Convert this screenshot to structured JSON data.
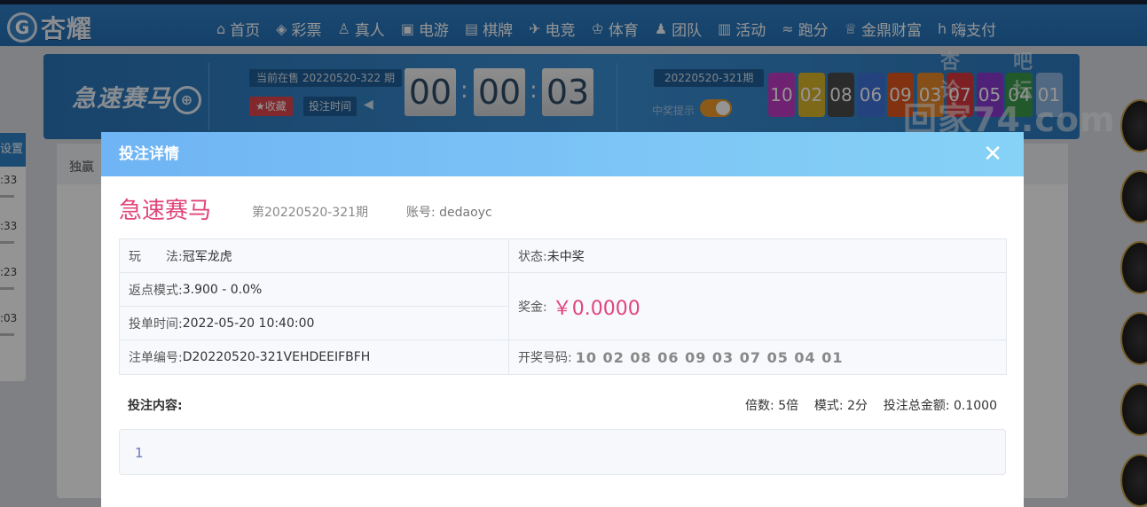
{
  "brand": {
    "logo_mark": "G",
    "name": "杏耀"
  },
  "nav": [
    {
      "icon": "⌂",
      "label": "首页"
    },
    {
      "icon": "◈",
      "label": "彩票"
    },
    {
      "icon": "♙",
      "label": "真人"
    },
    {
      "icon": "▣",
      "label": "电游"
    },
    {
      "icon": "▤",
      "label": "棋牌"
    },
    {
      "icon": "✈",
      "label": "电竞"
    },
    {
      "icon": "♔",
      "label": "体育"
    },
    {
      "icon": "♟",
      "label": "团队"
    },
    {
      "icon": "▥",
      "label": "活动"
    },
    {
      "icon": "≈",
      "label": "跑分"
    },
    {
      "icon": "♕",
      "label": "金鼎财富"
    },
    {
      "icon": "h",
      "label": "嗨支付"
    }
  ],
  "banner": {
    "game_title": "急速赛马",
    "current_issue": "当前在售 20220520-322 期",
    "favorite_label": "★收藏",
    "bet_time_label": "投注时间",
    "countdown": [
      "00",
      "00",
      "03"
    ],
    "last_issue": "20220520-321期",
    "win_tip_label": "中奖提示",
    "balls": [
      {
        "num": "10",
        "color": "#c13cc4"
      },
      {
        "num": "02",
        "color": "#d9b52b"
      },
      {
        "num": "08",
        "color": "#4a4a4a"
      },
      {
        "num": "06",
        "color": "#3e72d9"
      },
      {
        "num": "09",
        "color": "#e0561e"
      },
      {
        "num": "03",
        "color": "#e7882a"
      },
      {
        "num": "07",
        "color": "#d9383d"
      },
      {
        "num": "05",
        "color": "#8a3ad1"
      },
      {
        "num": "04",
        "color": "#3a9a4a"
      },
      {
        "num": "01",
        "color": "#8cb6e0"
      }
    ]
  },
  "background": {
    "side_header": "设置",
    "side_times": [
      ":33",
      ":33",
      ":23",
      ":03"
    ],
    "tabs_text": "独赢",
    "watermark_top": "杏吧 论坛",
    "watermark_bottom": "回家74.com"
  },
  "modal": {
    "header": "投注详情",
    "close": "✕",
    "game_name": "急速赛马",
    "issue": "第20220520-321期",
    "account_label": "账号:",
    "account_value": "dedaoyc",
    "play_label": "玩　　法:",
    "play_value": "冠军龙虎",
    "status_label": "状态:",
    "status_value": "未中奖",
    "rebate_label": "返点模式:",
    "rebate_value": "3.900 - 0.0%",
    "prize_label": "奖金:",
    "prize_value": "￥0.0000",
    "bet_time_label": "投单时间:",
    "bet_time_value": "2022-05-20 10:40:00",
    "order_label": "注单编号:",
    "order_value": "D20220520-321VEHDEEIFBFH",
    "draw_label": "开奖号码:",
    "draw_value": "10 02 08 06 09 03 07 05 04 01",
    "content_label": "投注内容:",
    "multiplier_label": "倍数:",
    "multiplier_value": "5倍",
    "mode_label": "模式:",
    "mode_value": "2分",
    "total_label": "投注总金额:",
    "total_value": "0.1000",
    "content_value": "1"
  }
}
